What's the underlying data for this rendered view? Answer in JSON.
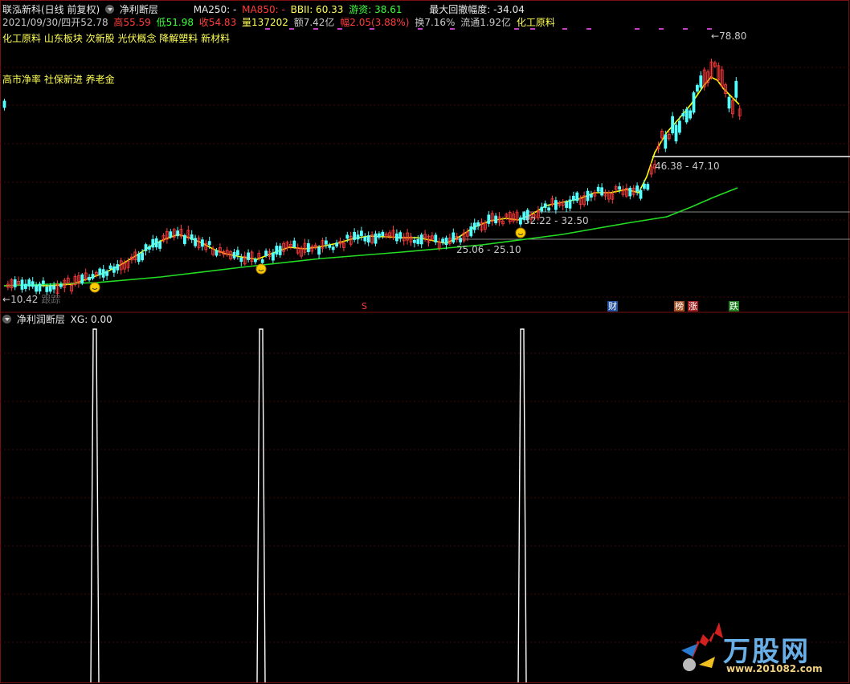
{
  "header": {
    "stock_title": "联泓新科(日线 前复权)",
    "indicator_name": "净利断层",
    "ma250_label": "MA250: -",
    "ma850_label": "MA850: -",
    "bbii_label": "BBII: 60.33",
    "youzi_label": "游资: 38.61",
    "max_drawdown_label": "最大回撤幅度: -34.04"
  },
  "quote": {
    "date": "2021/09/30/四",
    "open_label": "开",
    "open": "52.78",
    "high_label": "高",
    "high": "55.59",
    "low_label": "低",
    "low": "51.98",
    "close_label": "收",
    "close": "54.83",
    "volume_label": "量",
    "volume": "137202",
    "amount_label": "额",
    "amount": "7.42亿",
    "change_label": "幅",
    "change": "2.05(3.88%)",
    "turnover_label": "换",
    "turnover": "7.16%",
    "float_label": "流通",
    "float": "1.92亿",
    "sector": "化工原料"
  },
  "concepts_line1": "化工原料 山东板块 次新股 光伏概念 降解塑料 新材料",
  "concepts_line2": "高市净率 社保新进 养老金",
  "price_annotations": {
    "high_mark": "78.80",
    "zone1": "46.38 - 47.10",
    "zone2": "32.22 - 32.50",
    "zone3": "25.06 - 25.10",
    "low_mark": "10.42",
    "low_hint": "跟踪"
  },
  "event_tags": {
    "s": "S",
    "cai": "财",
    "bang": "榜",
    "zhang": "涨",
    "die": "跌"
  },
  "lower_panel": {
    "title": "净利润断层",
    "xg_label": "XG: 0.00"
  },
  "watermark": {
    "brand": "万股网",
    "url": "www.201082.com"
  },
  "colors": {
    "background": "#000000",
    "up_candle": "#ff3c3c",
    "down_candle": "#54ffff",
    "ma_short": "#ffff00",
    "ma_long": "#22dd22",
    "annotation": "#ff55ff"
  }
}
